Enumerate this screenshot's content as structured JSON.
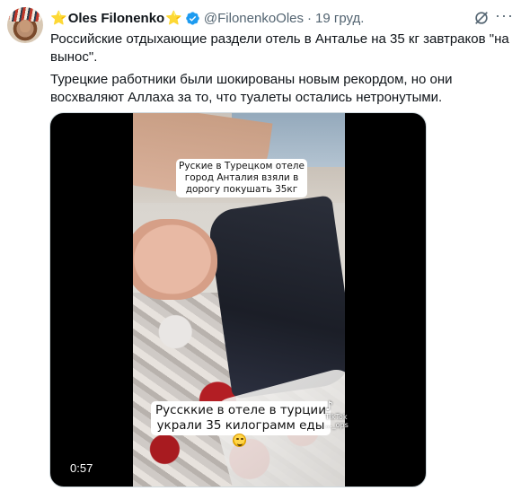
{
  "tweet": {
    "author": {
      "star_left": "⭐",
      "name": "Oles Filonenko",
      "star_right": "⭐",
      "handle": "@FilonenkoOles",
      "separator": "·",
      "date": "19 груд."
    },
    "text": {
      "paragraph1": "Российские отдыхающие раздели отель в Анталье на 35 кг завтраков \"на вынос\".",
      "paragraph2": "Турецкие работники были шокированы новым рекордом, но они восхваляют Аллаха за то, что туалеты остались нетронутыми."
    },
    "video": {
      "caption_top": "Руские в Турецком отеле город Анталия взяли в дорогу покушать 35кг",
      "caption_bottom_line1": "Руссккие в отеле в турции",
      "caption_bottom_line2": "украли 35 килограмм еды",
      "watermark": "TikTok",
      "watermark_handle": "..._ops",
      "duration": "0:57"
    },
    "icons": {
      "verified": "verified-badge-icon",
      "grok": "grok-icon",
      "more": "more-options-icon",
      "emoji": "laughing-emoji-icon"
    },
    "colors": {
      "verified": "#1d9bf0",
      "star": "#f5b50a",
      "secondary_text": "#536471"
    }
  }
}
